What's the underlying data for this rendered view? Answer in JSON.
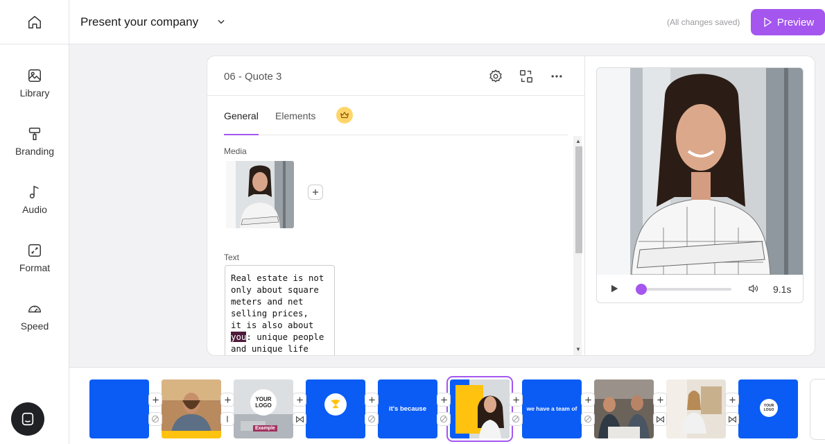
{
  "sidebar": {
    "items": [
      {
        "label": "Library",
        "icon": "library-icon"
      },
      {
        "label": "Branding",
        "icon": "paint-roller-icon"
      },
      {
        "label": "Audio",
        "icon": "music-note-icon"
      },
      {
        "label": "Format",
        "icon": "resize-icon"
      },
      {
        "label": "Speed",
        "icon": "speedometer-icon"
      }
    ]
  },
  "header": {
    "project_title": "Present your company",
    "saved_status": "(All changes saved)",
    "preview_label": "Preview"
  },
  "editor": {
    "slide_title": "06 - Quote 3",
    "tabs": [
      "General",
      "Elements"
    ],
    "media_label": "Media",
    "text_label": "Text",
    "text_before": "Real estate is not\nonly about square\nmeters and net\nselling prices,\nit is also about\n",
    "text_highlight": "you",
    "text_after": ": unique people\nand unique life"
  },
  "player": {
    "duration": "9.1s",
    "progress": 0.06
  },
  "filmstrip": {
    "slides": [
      {
        "text": ""
      },
      {
        "text": ""
      },
      {
        "text": "YOUR LOGO",
        "caption": "Example"
      },
      {
        "text": ""
      },
      {
        "text": "it's because"
      },
      {
        "text": ""
      },
      {
        "text": "we have a team of"
      },
      {
        "text": ""
      },
      {
        "text": ""
      },
      {
        "text": "YOUR LOGO"
      }
    ]
  },
  "colors": {
    "accent": "#a456ef",
    "brand_blue": "#0a5cf5",
    "brand_yellow": "#ffc20e"
  }
}
